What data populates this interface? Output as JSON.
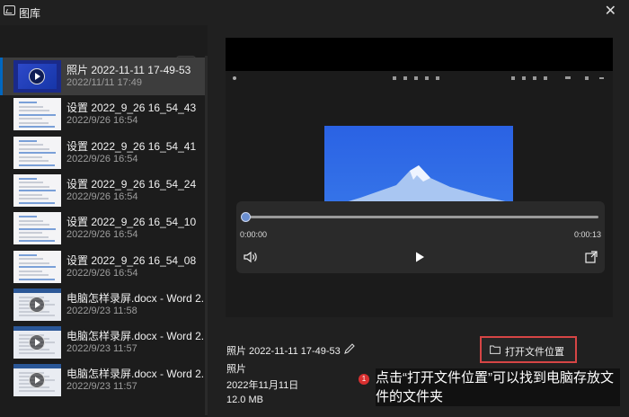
{
  "window": {
    "title": "图库",
    "close_glyph": "✕"
  },
  "list": {
    "items": [
      {
        "name": "照片 2022-11-11 17-49-53",
        "date": "2022/11/11 17:49",
        "kind": "photo-video",
        "selected": true
      },
      {
        "name": "设置 2022_9_26 16_54_43",
        "date": "2022/9/26 16:54",
        "kind": "screenshot",
        "selected": false
      },
      {
        "name": "设置 2022_9_26 16_54_41",
        "date": "2022/9/26 16:54",
        "kind": "screenshot",
        "selected": false
      },
      {
        "name": "设置 2022_9_26 16_54_24",
        "date": "2022/9/26 16:54",
        "kind": "screenshot",
        "selected": false
      },
      {
        "name": "设置 2022_9_26 16_54_10",
        "date": "2022/9/26 16:54",
        "kind": "screenshot",
        "selected": false
      },
      {
        "name": "设置 2022_9_26 16_54_08",
        "date": "2022/9/26 16:54",
        "kind": "screenshot",
        "selected": false
      },
      {
        "name": "电脑怎样录屏.docx - Word 2...",
        "date": "2022/9/23 11:58",
        "kind": "doc-video",
        "selected": false
      },
      {
        "name": "电脑怎样录屏.docx - Word 2...",
        "date": "2022/9/23 11:57",
        "kind": "doc-video",
        "selected": false
      },
      {
        "name": "电脑怎样录屏.docx - Word 2...",
        "date": "2022/9/23 11:57",
        "kind": "doc-video",
        "selected": false
      }
    ]
  },
  "player": {
    "time_current": "0:00:00",
    "time_total": "0:00:13",
    "progress": 0.0
  },
  "details": {
    "file_name": "照片 2022-11-11 17-49-53",
    "file_type": "照片",
    "file_date": "2022年11月11日",
    "file_size": "12.0 MB",
    "open_location_label": "打开文件位置"
  },
  "callout": {
    "badge": "1",
    "text": "点击“打开文件位置”可以找到电脑存放文件的文件夹"
  },
  "colors": {
    "accent": "#0067c0",
    "highlight_border": "#d64545",
    "badge": "#d93030"
  }
}
